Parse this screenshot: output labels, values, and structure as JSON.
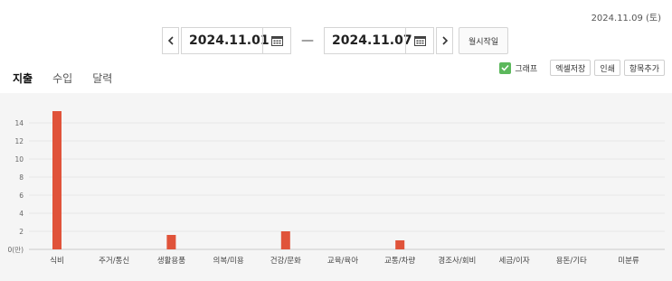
{
  "current_date": "2024.11.09 (토)",
  "date_range": {
    "start": "2024.11.01",
    "end": "2024.11.07",
    "separator": "—",
    "monthly_start_label": "월시작일"
  },
  "tabs": [
    {
      "label": "지출",
      "active": true
    },
    {
      "label": "수입",
      "active": false
    },
    {
      "label": "달력",
      "active": false
    }
  ],
  "toolbar": {
    "graph_label": "그래프",
    "graph_checked": true,
    "excel_label": "엑셀저장",
    "print_label": "인쇄",
    "add_item_label": "항목추가"
  },
  "colors": {
    "accent_green": "#4caf50",
    "checkbox_green": "#5cb85c",
    "bar_red": "#e0533a",
    "chart_bg": "#f5f5f5"
  },
  "chart_data": {
    "type": "bar",
    "categories": [
      "식비",
      "주거/통신",
      "생활용품",
      "의복/미용",
      "건강/문화",
      "교육/육아",
      "교통/차량",
      "경조사/회비",
      "세금/이자",
      "용돈/기타",
      "미분류"
    ],
    "values": [
      15.3,
      0,
      1.6,
      0,
      2.0,
      0,
      1.0,
      0,
      0,
      0,
      0
    ],
    "ytick_labels": [
      "0(만)",
      "2",
      "4",
      "6",
      "8",
      "10",
      "12",
      "14"
    ],
    "ylim": [
      0,
      16
    ],
    "grid": true,
    "legend": "none"
  }
}
